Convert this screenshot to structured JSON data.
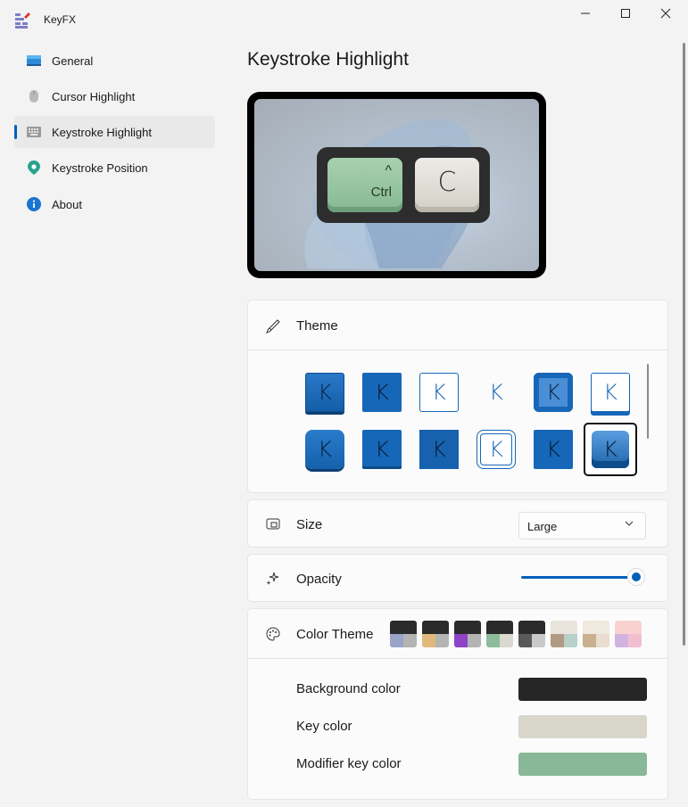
{
  "app": {
    "title": "KeyFX"
  },
  "sidebar": {
    "items": [
      {
        "label": "General",
        "icon": "monitor-icon"
      },
      {
        "label": "Cursor Highlight",
        "icon": "mouse-icon"
      },
      {
        "label": "Keystroke Highlight",
        "icon": "keyboard-icon",
        "selected": true
      },
      {
        "label": "Keystroke Position",
        "icon": "map-pin-icon"
      },
      {
        "label": "About",
        "icon": "info-icon"
      }
    ]
  },
  "page": {
    "title": "Keystroke Highlight"
  },
  "preview": {
    "keys": [
      {
        "label": "Ctrl",
        "symbol": "^"
      },
      {
        "label": "C"
      }
    ]
  },
  "theme": {
    "label": "Theme",
    "tile_letter": "K",
    "selected_index": 11
  },
  "size": {
    "label": "Size",
    "value": "Large"
  },
  "opacity": {
    "label": "Opacity",
    "value": 1.0
  },
  "color_theme": {
    "label": "Color Theme",
    "swatches": [
      {
        "top": "#2b2b2b",
        "bl": "#9aa3c8",
        "br": "#b4b4b4"
      },
      {
        "top": "#2b2b2b",
        "bl": "#e0b87c",
        "br": "#b4b4b4"
      },
      {
        "top": "#2b2b2b",
        "bl": "#8e44c4",
        "br": "#b4b4b4"
      },
      {
        "top": "#2b2b2b",
        "bl": "#8bbd9b",
        "br": "#dad8cf"
      },
      {
        "top": "#2b2b2b",
        "bl": "#5a5a5a",
        "br": "#c9c9c9"
      },
      {
        "top": "#e8e4dc",
        "bl": "#b09a83",
        "br": "#b7d1c8"
      },
      {
        "top": "#efe9de",
        "bl": "#c9b08f",
        "br": "#e8ddd0"
      },
      {
        "top": "#f9d2cf",
        "bl": "#d1b3e0",
        "br": "#f2bfd1"
      }
    ],
    "rows": [
      {
        "label": "Background color",
        "color": "#262626"
      },
      {
        "label": "Key color",
        "color": "#d8d6cb"
      },
      {
        "label": "Modifier key color",
        "color": "#88b898"
      }
    ]
  }
}
